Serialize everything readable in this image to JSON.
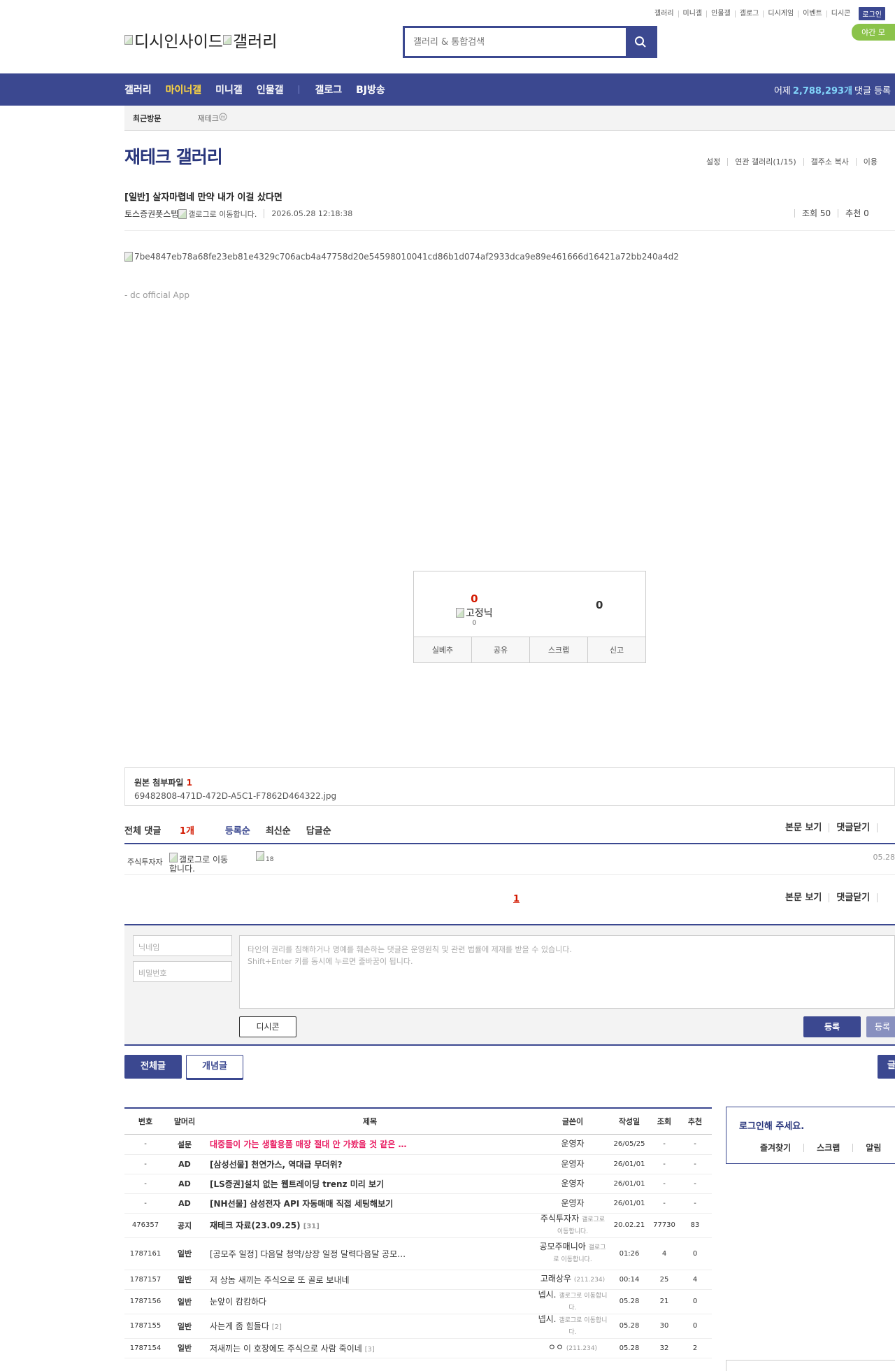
{
  "header": {
    "util_links": [
      "갤러리",
      "미니갤",
      "인물갤",
      "갤로그",
      "디시게임",
      "이벤트",
      "디시콘"
    ],
    "login_label": "로그인",
    "night_mode_label": "야간 모",
    "logo_text_1": "디시인사이드",
    "logo_text_2": "갤러리",
    "search_placeholder": "갤러리 & 통합검색"
  },
  "gnb": {
    "items": [
      "갤러리",
      "마이너갤",
      "미니갤",
      "인물갤",
      "갤로그",
      "BJ방송"
    ],
    "yesterday_prefix": "어제",
    "yesterday_count": "2,788,293개",
    "yesterday_suffix": "댓글 등록"
  },
  "recent": {
    "label": "최근방문",
    "gallery": "재테크"
  },
  "gallery": {
    "title": "재테크 갤러리",
    "links": [
      "설정",
      "연관 갤러리(1/15)",
      "갤주소 복사",
      "이용"
    ]
  },
  "post": {
    "title": "[일반] 살자마렵네 만약 내가 이걸 샀다면",
    "author": "토스증권폿스텝",
    "author_icon_alt": "갤로그로 이동합니다.",
    "date": "2026.05.28 12:18:38",
    "views": "조회 50",
    "recommend": "추천 0",
    "image_alt": "7be4847eb78a68fe23eb81e4329c706acb4a47758d20e54598010041cd86b1d074af2933dca9e89e461666d16421a72bb240a4d2",
    "app_sign": "- dc official App"
  },
  "recommend_box": {
    "up_count": "0",
    "fixed_nick_alt": "고정닉",
    "fixed_nick_count": "0",
    "down_count": "0",
    "buttons": [
      "실베추",
      "공유",
      "스크랩",
      "신고"
    ]
  },
  "attachment": {
    "label": "원본 첨부파일",
    "count": "1",
    "filename": "69482808-471D-472D-A5C1-F7862D464322.jpg"
  },
  "comments": {
    "total_label": "전체 댓글",
    "total_count": "1개",
    "sort": [
      "등록순",
      "최신순",
      "답글순"
    ],
    "actions": [
      "본문 보기",
      "댓글닫기"
    ],
    "items": [
      {
        "nick": "주식투자자",
        "icon_alt": "갤로그로 이동합니다.",
        "dccon_alt": "18",
        "date": "05.28"
      }
    ],
    "page": "1"
  },
  "write": {
    "nick_placeholder": "닉네임",
    "pw_placeholder": "비밀번호",
    "textarea_line1": "타인의 권리를 침해하거나 명예를 훼손하는 댓글은 운영원칙 및 관련 법률에 제재를 받을 수 있습니다.",
    "textarea_line2": "Shift+Enter 키를 동시에 누르면 줄바꿈이 됩니다.",
    "dccon_label": "디시콘",
    "submit_label": "등록",
    "submit2_label": "등록"
  },
  "list_tabs": {
    "all": "전체글",
    "best": "개념글",
    "write": "글"
  },
  "list": {
    "headers": [
      "번호",
      "말머리",
      "제목",
      "글쓴이",
      "작성일",
      "조회",
      "추천"
    ],
    "rows": [
      {
        "no": "-",
        "head": "설문",
        "title": "대중들이 가는 생활용품 매장 절대 안 가봤을 것 같은 …",
        "reply": "",
        "writer": "운영자",
        "ip": "",
        "date": "26/05/25",
        "views": "-",
        "rec": "-"
      },
      {
        "no": "-",
        "head": "AD",
        "title": "[삼성선물] 천연가스, 역대급 무더위?",
        "reply": "",
        "writer": "운영자",
        "ip": "",
        "date": "26/01/01",
        "views": "-",
        "rec": "-"
      },
      {
        "no": "-",
        "head": "AD",
        "title": "[LS증권]설치 없는 웹트레이딩 trenz 미리 보기",
        "reply": "",
        "writer": "운영자",
        "ip": "",
        "date": "26/01/01",
        "views": "-",
        "rec": "-"
      },
      {
        "no": "-",
        "head": "AD",
        "title": "[NH선물] 삼성전자 API 자동매매 직접 세팅해보기",
        "reply": "",
        "writer": "운영자",
        "ip": "",
        "date": "26/01/01",
        "views": "-",
        "rec": "-"
      },
      {
        "no": "476357",
        "head": "공지",
        "title": "재테크 자료(23.09.25)",
        "reply": "[31]",
        "writer": "주식투자자",
        "ip": "갤로그로 이동합니다.",
        "date": "20.02.21",
        "views": "77730",
        "rec": "83"
      },
      {
        "no": "1787161",
        "head": "일반",
        "title": "[공모주 일정] 다음달 청약/상장 일정 달력다음달 공모…",
        "reply": "",
        "writer": "공모주매니아",
        "ip": "갤로그로 이동합니다.",
        "date": "01:26",
        "views": "4",
        "rec": "0"
      },
      {
        "no": "1787157",
        "head": "일반",
        "title": "저 상놈 새끼는 주식으로 또 골로 보내네",
        "reply": "",
        "writer": "고래상우",
        "ip": "(211.234)",
        "date": "00:14",
        "views": "25",
        "rec": "4"
      },
      {
        "no": "1787156",
        "head": "일반",
        "title": "눈앞이 캄캄하다",
        "reply": "",
        "writer": "넵시.",
        "ip": "갤로그로 이동합니다.",
        "date": "05.28",
        "views": "21",
        "rec": "0"
      },
      {
        "no": "1787155",
        "head": "일반",
        "title": "사는게 좀 힘들다",
        "reply": "[2]",
        "writer": "넵시.",
        "ip": "갤로그로 이동합니다.",
        "date": "05.28",
        "views": "30",
        "rec": "0"
      },
      {
        "no": "1787154",
        "head": "일반",
        "title": "저새끼는 이 호장에도 주식으로 사람 죽이네",
        "reply": "[3]",
        "writer": "ㅇㅇ",
        "ip": "(211.234)",
        "date": "05.28",
        "views": "32",
        "rec": "2"
      }
    ]
  },
  "sidebar": {
    "login_prompt": "로그인해 주세요.",
    "menu": [
      "즐겨찾기",
      "스크랩",
      "알림"
    ]
  }
}
